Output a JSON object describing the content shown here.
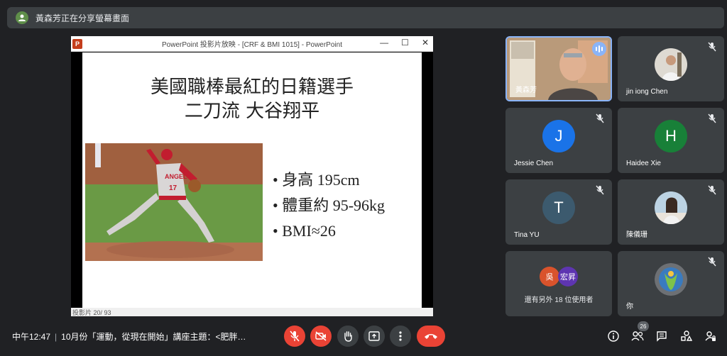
{
  "banner": {
    "text": "黃森芳正在分享螢幕畫面"
  },
  "presentation": {
    "window_title": "PowerPoint 投影片放映 - [CRF & BMI 1015] - PowerPoint",
    "app_badge": "P",
    "slide_title_line1": "美國職棒最紅的日籍選手",
    "slide_title_line2": "二刀流  大谷翔平",
    "bullets": [
      "身高 195cm",
      "體重約 95-96kg",
      "BMI≈26"
    ],
    "status": "投影片 20/ 93",
    "photo_jersey": "ANGELS",
    "photo_number": "17"
  },
  "participants": [
    {
      "name": "黃森芳",
      "type": "video",
      "speaking": true
    },
    {
      "name": "jin iong Chen",
      "type": "photo",
      "muted": true
    },
    {
      "name": "Jessie Chen",
      "initial": "J",
      "color": "#1a73e8",
      "muted": true
    },
    {
      "name": "Haidee Xie",
      "initial": "H",
      "color": "#188038",
      "muted": true
    },
    {
      "name": "Tina YU",
      "initial": "T",
      "color": "#3c5a6e",
      "muted": true
    },
    {
      "name": "陳儀珊",
      "type": "photo",
      "muted": true
    },
    {
      "name": "你",
      "type": "logo",
      "muted": true
    }
  ],
  "others": {
    "avatars": [
      "吳",
      "宏昇"
    ],
    "text": "還有另外 18 位使用者"
  },
  "footer": {
    "time": "中午12:47",
    "meeting": "10月份「運動，從現在開始」講座主題：<肥胖…",
    "people_count": "26"
  },
  "colors": {
    "accent": "#8ab4f8",
    "danger": "#ea4335",
    "surface": "#3c4043",
    "background": "#202124"
  }
}
